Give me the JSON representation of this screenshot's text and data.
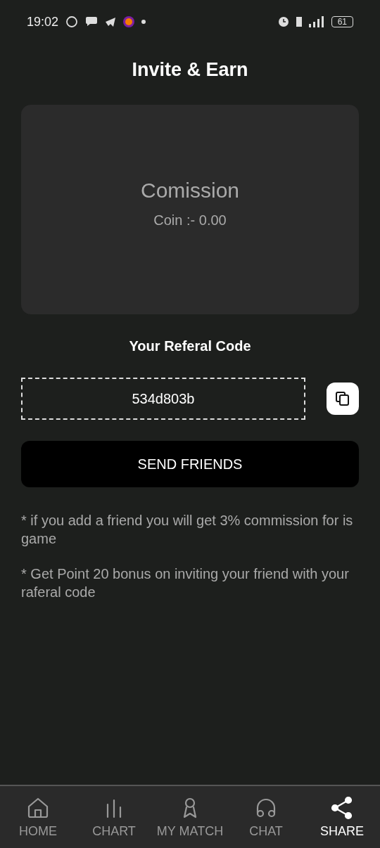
{
  "status_bar": {
    "time": "19:02",
    "battery": "61"
  },
  "title": "Invite & Earn",
  "commission_card": {
    "heading": "Comission",
    "coin": "Coin :- 0.00"
  },
  "referral": {
    "heading": "Your Referal Code",
    "code": "534d803b"
  },
  "send_button": "SEND FRIENDS",
  "notes": [
    "* if you add a friend you will get 3% commission for is game",
    "* Get Point 20 bonus on inviting your friend with your raferal code"
  ],
  "nav": [
    {
      "kind": "home",
      "label": "HOME",
      "selected": false
    },
    {
      "kind": "chart",
      "label": "CHART",
      "selected": false
    },
    {
      "kind": "match",
      "label": "MY MATCH",
      "selected": false
    },
    {
      "kind": "chat",
      "label": "CHAT",
      "selected": false
    },
    {
      "kind": "share",
      "label": "SHARE",
      "selected": true
    }
  ]
}
